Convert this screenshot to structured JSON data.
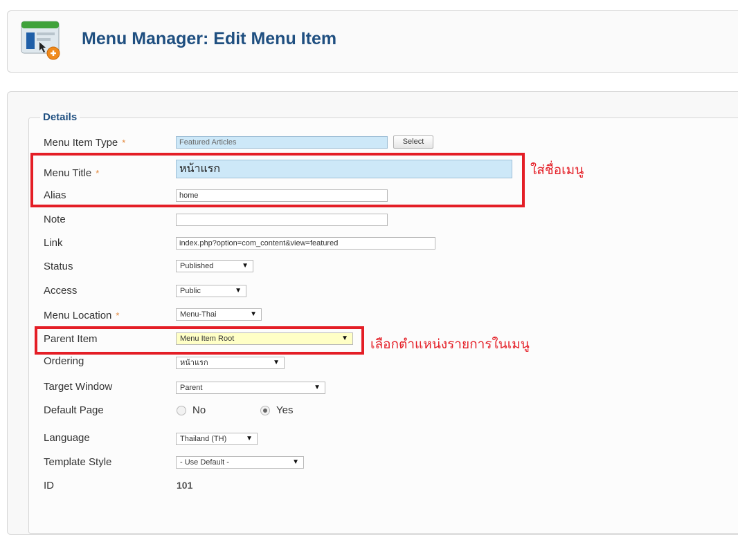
{
  "header": {
    "title": "Menu Manager: Edit Menu Item",
    "icon": "menu-add-icon"
  },
  "details": {
    "legend": "Details",
    "required_marker": "*",
    "menu_item_type": {
      "label": "Menu Item Type",
      "value": "Featured Articles",
      "button": "Select"
    },
    "menu_title": {
      "label": "Menu Title",
      "value": "หน้าแรก"
    },
    "alias": {
      "label": "Alias",
      "value": "home"
    },
    "note": {
      "label": "Note",
      "value": ""
    },
    "link": {
      "label": "Link",
      "value": "index.php?option=com_content&view=featured"
    },
    "status": {
      "label": "Status",
      "value": "Published"
    },
    "access": {
      "label": "Access",
      "value": "Public"
    },
    "menu_location": {
      "label": "Menu Location",
      "value": "Menu-Thai"
    },
    "parent_item": {
      "label": "Parent Item",
      "value": "Menu Item Root"
    },
    "ordering": {
      "label": "Ordering",
      "value": "หน้าแรก"
    },
    "target_window": {
      "label": "Target Window",
      "value": "Parent"
    },
    "default_page": {
      "label": "Default Page",
      "options": [
        "No",
        "Yes"
      ],
      "selected": "Yes"
    },
    "language": {
      "label": "Language",
      "value": "Thailand (TH)"
    },
    "template_style": {
      "label": "Template Style",
      "value": "- Use Default -"
    },
    "id": {
      "label": "ID",
      "value": "101"
    }
  },
  "annotations": {
    "menu_title_note": "ใส่ชื่อเมนู",
    "parent_item_note": "เลือกตำแหน่งรายการในเมนู",
    "highlight_color": "#e41e26"
  },
  "theme": {
    "title_color": "#1f4f80",
    "required_color": "#e3873a",
    "field_blue": "#cde8f8",
    "field_yellow": "#ffffc6"
  }
}
